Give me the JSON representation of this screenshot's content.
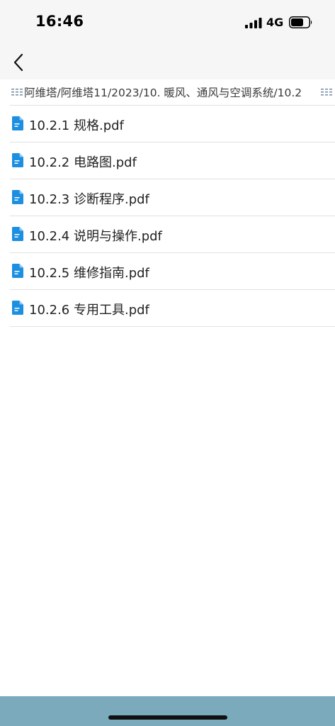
{
  "status_bar": {
    "time": "16:46",
    "network": "4G"
  },
  "nav": {
    "back_icon": "chevron-left-icon"
  },
  "breadcrumb": {
    "path": "阿维塔/阿维塔11/2023/10. 暖风、通风与空调系统/10.2"
  },
  "files": [
    {
      "name": "10.2.1 规格.pdf",
      "icon": "pdf-file-icon"
    },
    {
      "name": "10.2.2 电路图.pdf",
      "icon": "pdf-file-icon"
    },
    {
      "name": "10.2.3 诊断程序.pdf",
      "icon": "pdf-file-icon"
    },
    {
      "name": "10.2.4 说明与操作.pdf",
      "icon": "pdf-file-icon"
    },
    {
      "name": "10.2.5 维修指南.pdf",
      "icon": "pdf-file-icon"
    },
    {
      "name": "10.2.6 专用工具.pdf",
      "icon": "pdf-file-icon"
    }
  ],
  "colors": {
    "top_background": "#f6f6f6",
    "file_icon": "#1c8fe0",
    "divider": "#e2e2e2",
    "bottom_bar": "#7aaabb"
  }
}
